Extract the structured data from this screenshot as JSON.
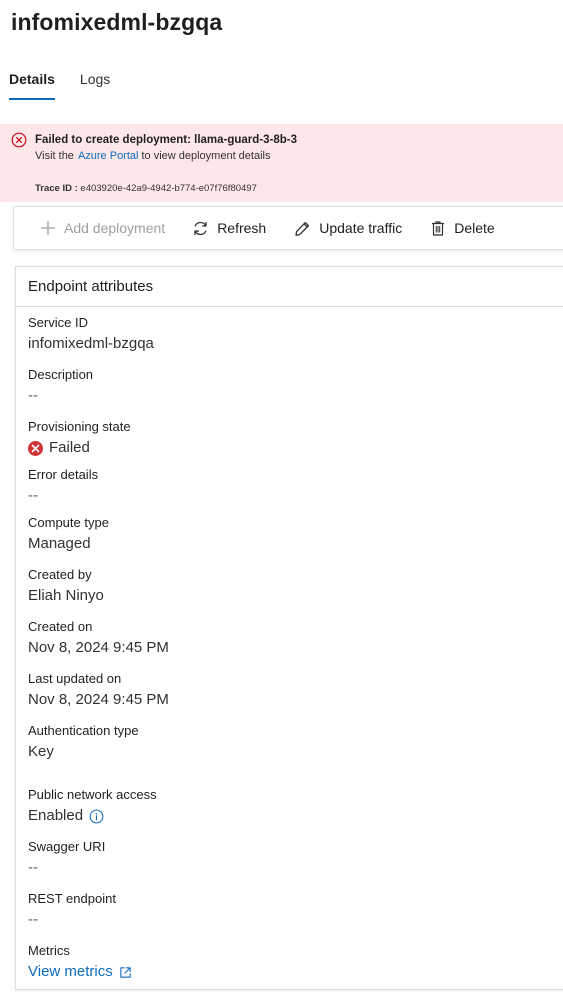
{
  "page": {
    "title": "infomixedml-bzgqa"
  },
  "tabs": [
    {
      "label": "Details",
      "active": true
    },
    {
      "label": "Logs",
      "active": false
    }
  ],
  "error_banner": {
    "title": "Failed to create deployment: llama-guard-3-8b-3",
    "pre_link": "Visit the",
    "link_text": "Azure Portal",
    "post_link": "to view deployment details",
    "trace_label": "Trace ID :",
    "trace_value": "e403920e-42a9-4942-b774-e07f76f80497",
    "color": "#fde7e9"
  },
  "toolbar": {
    "add_deployment": "Add deployment",
    "refresh": "Refresh",
    "update_traffic": "Update traffic",
    "delete": "Delete"
  },
  "card": {
    "title": "Endpoint attributes",
    "fields": {
      "service_id": {
        "label": "Service ID",
        "value": "infomixedml-bzgqa"
      },
      "description": {
        "label": "Description",
        "value": "--"
      },
      "provisioning_state": {
        "label": "Provisioning state",
        "value": "Failed"
      },
      "error_details": {
        "label": "Error details",
        "value": "--"
      },
      "compute_type": {
        "label": "Compute type",
        "value": "Managed"
      },
      "created_by": {
        "label": "Created by",
        "value": "Eliah Ninyo"
      },
      "created_on": {
        "label": "Created on",
        "value": "Nov 8, 2024 9:45 PM"
      },
      "last_updated_on": {
        "label": "Last updated on",
        "value": "Nov 8, 2024 9:45 PM"
      },
      "authentication_type": {
        "label": "Authentication type",
        "value": "Key"
      },
      "public_network_access": {
        "label": "Public network access",
        "value": "Enabled"
      },
      "swagger_uri": {
        "label": "Swagger URI",
        "value": "--"
      },
      "rest_endpoint": {
        "label": "REST endpoint",
        "value": "--"
      },
      "metrics": {
        "label": "Metrics",
        "value": "View metrics"
      }
    }
  },
  "colors": {
    "accent": "#0f6cbd",
    "error": "#d13438"
  }
}
